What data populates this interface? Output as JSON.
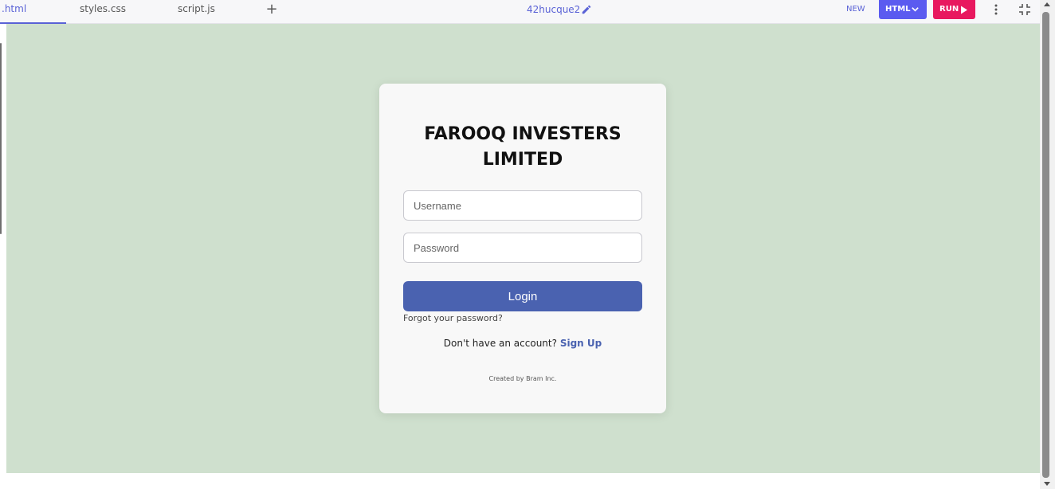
{
  "editor": {
    "tabs": [
      {
        "label": ".html",
        "active": true
      },
      {
        "label": "styles.css",
        "active": false
      },
      {
        "label": "script.js",
        "active": false
      }
    ],
    "add_tab_symbol": "+",
    "project_name": "42hucque2",
    "new_label": "NEW",
    "language_button": "HTML",
    "run_button": "RUN",
    "colors": {
      "accent": "#5b5bf0",
      "run": "#e8185f",
      "preview_background": "#cfe0ce"
    }
  },
  "login": {
    "company_name": "FAROOQ INVESTERS LIMITED",
    "username_placeholder": "Username",
    "password_placeholder": "Password",
    "login_button": "Login",
    "forgot_password": "Forgot your password?",
    "no_account_text": "Don't have an account?",
    "signup_link": "Sign Up",
    "credit": "Created by Bram Inc.",
    "colors": {
      "button": "#4a62b0",
      "card": "#f8f8f8"
    }
  }
}
